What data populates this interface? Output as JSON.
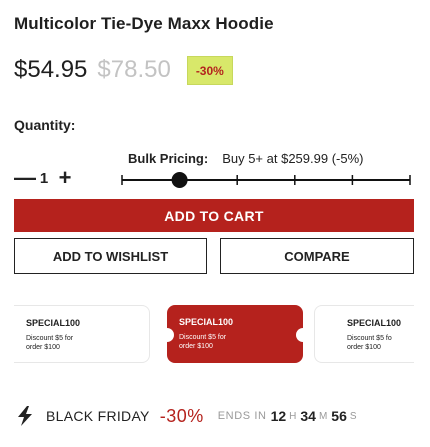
{
  "product": {
    "title": "Multicolor Tie-Dye Maxx Hoodie",
    "price": "$54.95",
    "original_price": "$78.50",
    "discount_badge": "-30%"
  },
  "quantity": {
    "label": "Quantity:",
    "decrement": "—",
    "value": "1",
    "increment": "+"
  },
  "bulk_pricing": {
    "label": "Bulk Pricing:",
    "text": "Buy 5+ at $259.99 (-5%)",
    "slider_level": 0.2,
    "slider_ticks": 5
  },
  "actions": {
    "add_to_cart": "ADD TO CART",
    "add_to_wishlist": "ADD TO WISHLIST",
    "compare": "COMPARE"
  },
  "coupons": [
    {
      "code": "SPECIAL100",
      "line1": "Discount $5 for",
      "line2": "order $100"
    },
    {
      "code": "SPECIAL100",
      "line1": "Discount $5 for",
      "line2": "order $100"
    },
    {
      "code": "SPECIAL100",
      "line1": "Discount $5 fo",
      "line2": "order $100"
    }
  ],
  "promo": {
    "icon": "lightning-bolt-icon",
    "label": "BLACK FRIDAY",
    "percent": "-30%",
    "ends_in": "ENDS IN",
    "hours": "12",
    "hours_unit": "H",
    "minutes": "34",
    "minutes_unit": "M",
    "seconds": "56",
    "seconds_unit": "S"
  },
  "colors": {
    "accent_red": "#b5221d",
    "badge_bg": "#d8e86a",
    "muted_price": "#c3c3c3"
  }
}
